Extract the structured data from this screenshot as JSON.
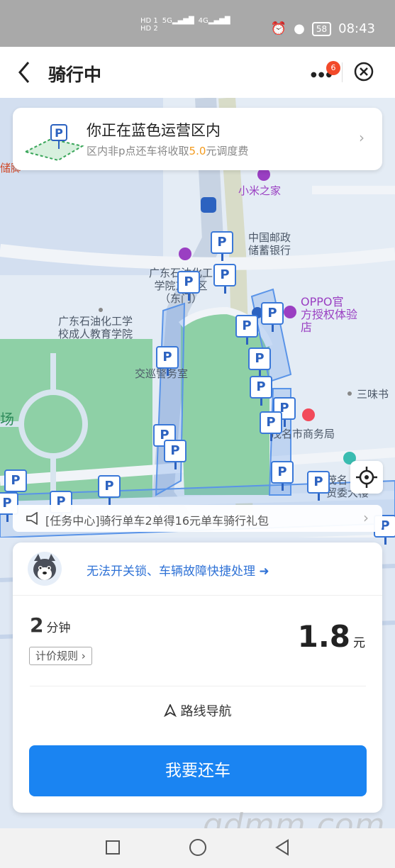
{
  "status_bar": {
    "sim1": "HD 1",
    "sim2": "HD 2",
    "net1": "5G",
    "net2": "4G",
    "battery": "58",
    "time": "08:43"
  },
  "nav": {
    "title": "骑行中",
    "badge": "6"
  },
  "zone_card": {
    "title": "你正在蓝色运营区内",
    "sub_prefix": "区内非p点还车将收取",
    "fee": "5.0",
    "sub_suffix": "元调度费"
  },
  "map": {
    "pois": [
      "小米之家",
      "中国邮政\n储蓄银行",
      "广东石油化工\n学院东校区\n（东门）",
      "广东石油化工学\n校成人教育学院",
      "OPPO官\n方授权体验\n店",
      "交巡警务室",
      "三味书",
      "茂名市商务局",
      "茂名\n贸委大楼",
      "场",
      "储脚",
      "P"
    ]
  },
  "task_bar": {
    "text": "[任务中心]骑行单车2单得16元单车骑行礼包"
  },
  "panel": {
    "help_text": "无法开关锁、车辆故障快捷处理",
    "duration_value": "2",
    "duration_unit": "分钟",
    "pricing_rule": "计价规则",
    "price_value": "1.8",
    "price_unit": "元",
    "route_nav": "路线导航",
    "return_button": "我要还车"
  },
  "watermark": "gdmm.com",
  "colors": {
    "accent": "#1a84f2",
    "fee": "#f39b1e",
    "link": "#2f72d6",
    "badge": "#f24a2a",
    "parking": "#3a78d8"
  }
}
